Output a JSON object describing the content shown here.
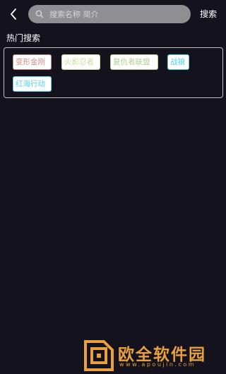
{
  "header": {
    "back_icon": "chevron-left-icon",
    "search": {
      "placeholder": "搜索名称 简介",
      "value": "",
      "icon": "search-icon"
    },
    "search_button_label": "搜索"
  },
  "hot_search": {
    "title": "热门搜索",
    "tags": [
      {
        "label": "变形金刚",
        "color": "#c98d86"
      },
      {
        "label": "火影忍者",
        "color": "#c6df9c"
      },
      {
        "label": "复仇者联盟",
        "color": "#b4cf8f"
      },
      {
        "label": "战狼",
        "color": "#55d0e8"
      },
      {
        "label": "红海行动",
        "color": "#55d0e8"
      }
    ]
  },
  "watermark": {
    "title": "欧全软件园",
    "url": "www.apoujin.com",
    "icon": "logo-icon",
    "color": "#e8a13c"
  },
  "colors": {
    "background": "#13121d",
    "search_box": "#8e8e93",
    "panel_border": "#bfbfc4"
  }
}
